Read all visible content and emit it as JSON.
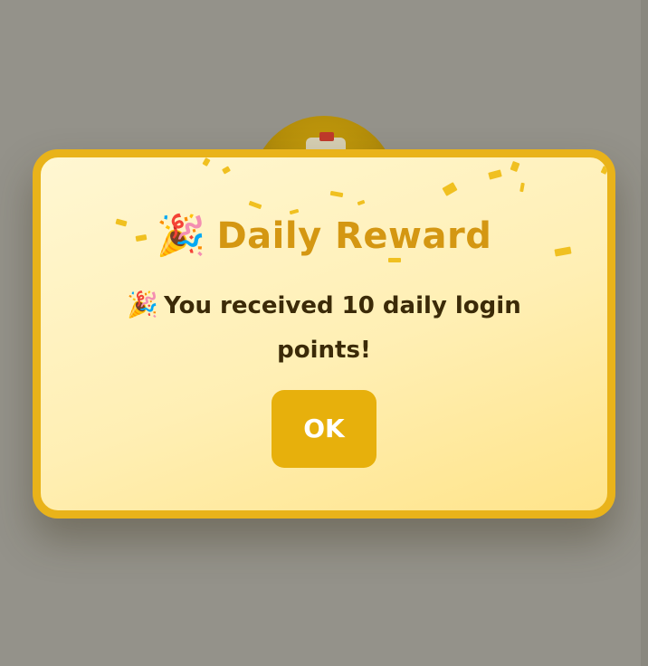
{
  "dialog": {
    "title": "Daily Reward",
    "title_icon": "party-popper-icon",
    "message_icon": "party-popper-icon",
    "message": "You received 10 daily login points!",
    "ok_label": "OK"
  },
  "colors": {
    "backdrop": "#94928a",
    "dialog_border": "#e9b31a",
    "dialog_background": "#fff3c4",
    "title": "#d49712",
    "message": "#3b2a08",
    "button": "#e7b00c",
    "button_text": "#ffffff",
    "confetti": "#f0c020"
  }
}
